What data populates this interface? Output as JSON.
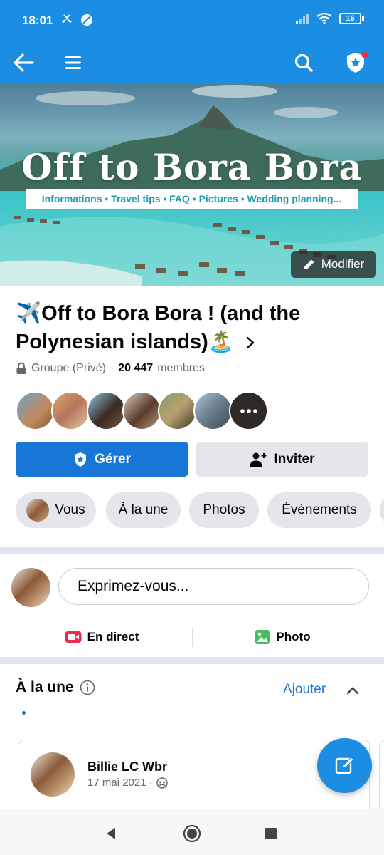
{
  "status_bar": {
    "time": "18:01",
    "battery": "16"
  },
  "cover": {
    "title": "Off to Bora Bora",
    "strip": "Informations • Travel tips • FAQ • Pictures • Wedding planning...",
    "modify_label": "Modifier"
  },
  "group": {
    "name": "✈️Off to Bora Bora ! (and the Polynesian islands)🏝️",
    "privacy": "Groupe (Privé)",
    "separator": "·",
    "member_count": "20 447",
    "members_label": "membres"
  },
  "actions": {
    "manage_label": "Gérer",
    "invite_label": "Inviter"
  },
  "tabs": [
    {
      "label": "Vous"
    },
    {
      "label": "À la une"
    },
    {
      "label": "Photos"
    },
    {
      "label": "Évènements"
    }
  ],
  "composer": {
    "placeholder": "Exprimez-vous...",
    "live_label": "En direct",
    "photo_label": "Photo"
  },
  "featured": {
    "title": "À la une",
    "add_label": "Ajouter",
    "post": {
      "author": "Billie LC Wbr",
      "date": "17 mai 2021 ·"
    }
  },
  "colors": {
    "accent": "#1b8ee4",
    "button_blue": "#1877d6",
    "chip_gray": "#e4e6eb"
  }
}
